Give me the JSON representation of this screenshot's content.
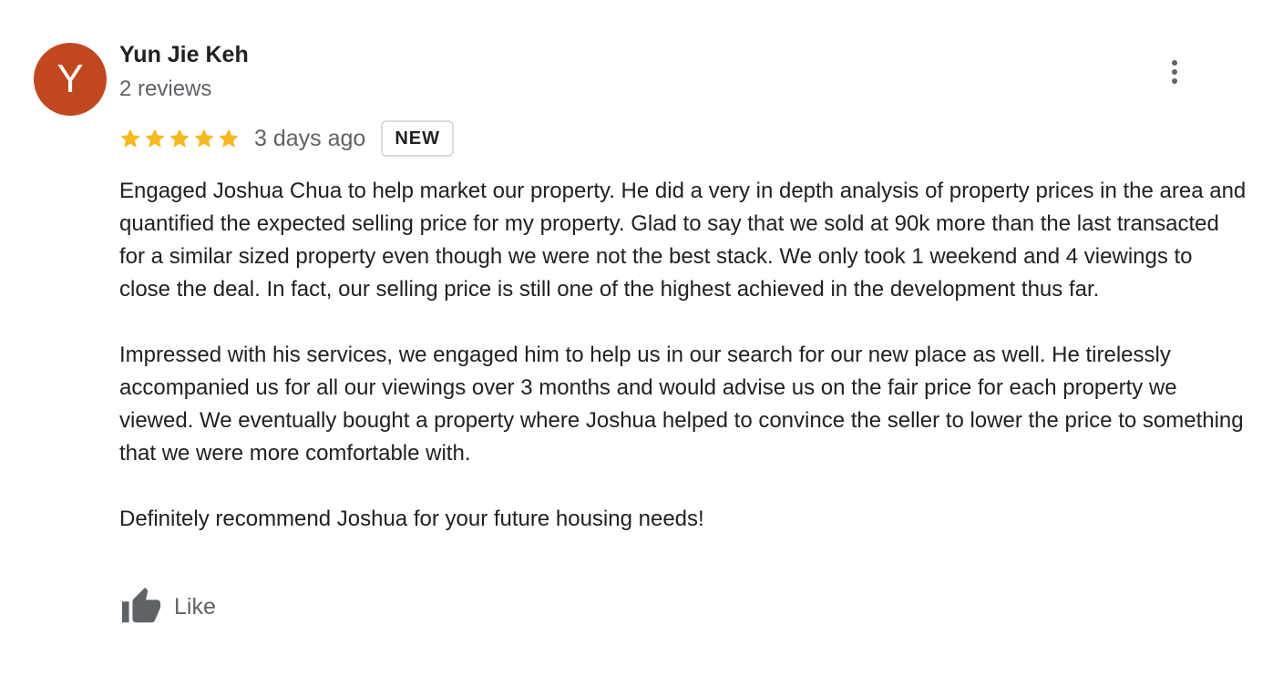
{
  "review": {
    "avatar_initial": "Y",
    "avatar_color": "#c1471f",
    "author_name": "Yun Jie Keh",
    "author_meta": "2 reviews",
    "rating": 5,
    "rating_max": 5,
    "star_color": "#f5b921",
    "date": "3 days ago",
    "badge": "NEW",
    "paragraphs": [
      "Engaged Joshua Chua to help market our property. He did a very in depth analysis of property prices in the area and quantified the expected selling price for my property. Glad to say that we sold at 90k more than the last transacted for a similar sized property even though we were not the best stack. We only took 1 weekend and 4 viewings to close the deal. In fact, our selling price is still one of the highest achieved in the development thus far.",
      "Impressed with his services, we engaged him to help us in our search for our new place as well. He tirelessly accompanied us for all our viewings over 3 months and would advise us on the fair price for each property we viewed. We eventually bought a property where Joshua helped to convince the seller to lower the price to something that we were more comfortable with.",
      "Definitely recommend Joshua for your future housing needs!"
    ],
    "like_label": "Like",
    "icons": {
      "more": "more-vert-icon",
      "star": "star-icon",
      "like": "thumbs-up-icon"
    }
  }
}
